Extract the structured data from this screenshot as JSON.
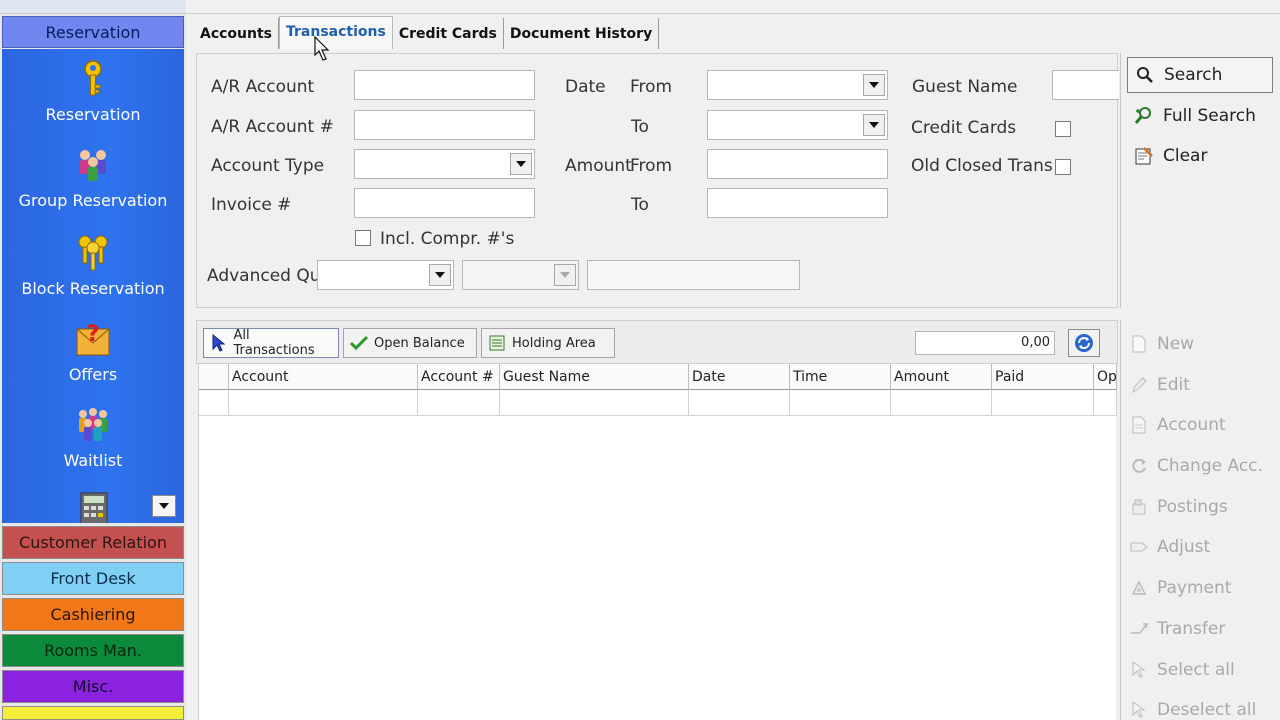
{
  "sidebar": {
    "header": "Reservation",
    "items": [
      {
        "label": "Reservation",
        "icon": "key-icon"
      },
      {
        "label": "Group Reservation",
        "icon": "group-icon"
      },
      {
        "label": "Block Reservation",
        "icon": "keys-icon"
      },
      {
        "label": "Offers",
        "icon": "question-icon"
      },
      {
        "label": "Waitlist",
        "icon": "people-icon"
      }
    ],
    "categories": [
      {
        "label": "Customer Relation",
        "color": "#c55050",
        "text": "#2a1515"
      },
      {
        "label": "Front Desk",
        "color": "#7fd0f4",
        "text": "#0d2d4a"
      },
      {
        "label": "Cashiering",
        "color": "#f07818",
        "text": "#2a1400"
      },
      {
        "label": "Rooms Man.",
        "color": "#0c8a3c",
        "text": "#062810"
      },
      {
        "label": "Misc.",
        "color": "#8a22e0",
        "text": "#1a0630"
      }
    ]
  },
  "tabs": [
    {
      "label": "Accounts"
    },
    {
      "label": "Transactions",
      "active": true
    },
    {
      "label": "Credit Cards"
    },
    {
      "label": "Document History"
    }
  ],
  "search": {
    "ar_account": "A/R Account",
    "ar_account_no": "A/R Account #",
    "account_type": "Account Type",
    "invoice_no": "Invoice #",
    "incl_compr": "Incl. Compr. #'s",
    "advanced_query": "Advanced Query",
    "date": "Date",
    "from": "From",
    "to": "To",
    "amount": "Amount",
    "from2": "From",
    "to2": "To",
    "guest_name": "Guest Name",
    "credit_cards": "Credit Cards",
    "old_closed_trans": "Old Closed Trans"
  },
  "actions_top": {
    "search": "Search",
    "full_search": "Full Search",
    "clear": "Clear"
  },
  "gridbar": {
    "all_transactions": "All Transactions",
    "open_balance": "Open Balance",
    "holding_area": "Holding Area",
    "amount": "0,00"
  },
  "grid": {
    "columns": [
      "Account",
      "Account #",
      "Guest Name",
      "Date",
      "Time",
      "Amount",
      "Paid",
      "Op"
    ]
  },
  "actions_bottom": {
    "new": "New",
    "edit": "Edit",
    "account": "Account",
    "change_acc": "Change Acc.",
    "postings": "Postings",
    "adjust": "Adjust",
    "payment": "Payment",
    "transfer": "Transfer",
    "select_all": "Select all",
    "deselect_all": "Deselect all"
  }
}
